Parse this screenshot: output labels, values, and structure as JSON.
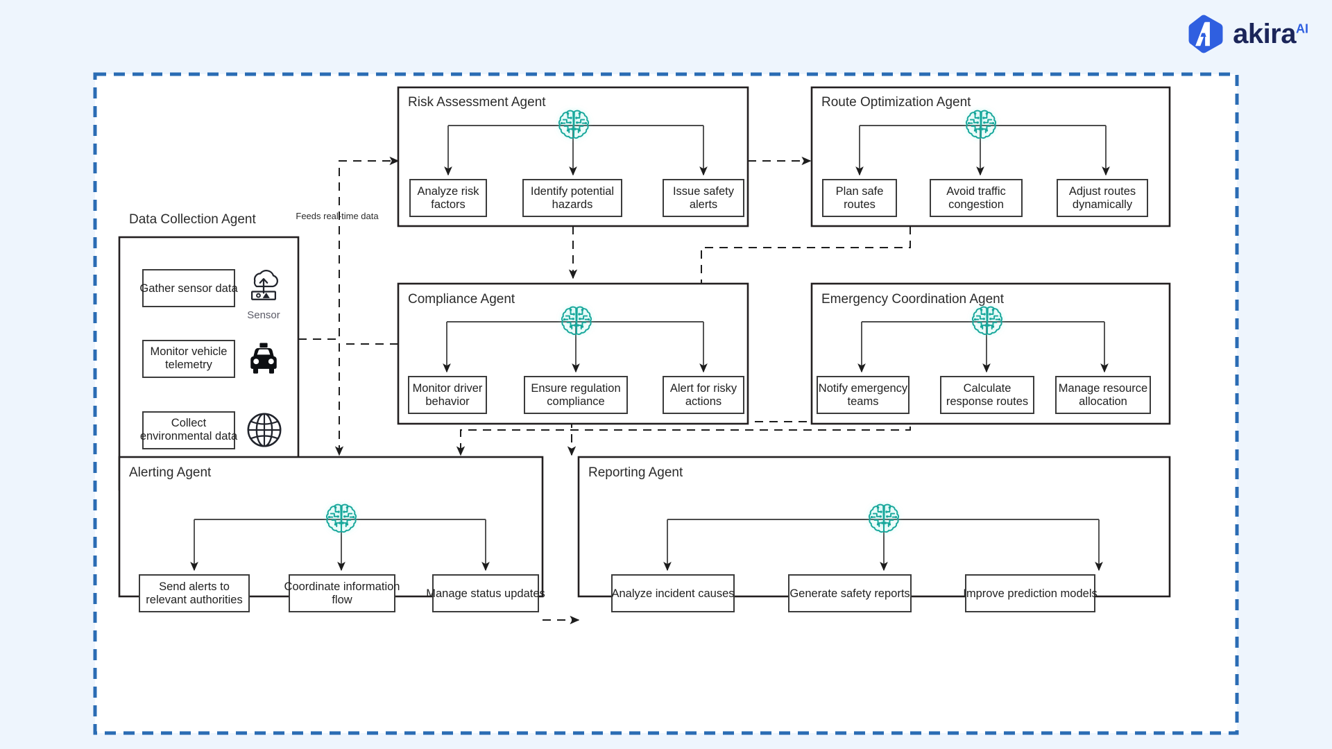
{
  "brand": {
    "name": "akira",
    "superscript": "AI",
    "mark_icon": "akira-hexagon-a-logo",
    "hex_color": "#2f5fe0",
    "word_color": "#1b2559"
  },
  "canvas": {
    "border_color": "#2a6cb4",
    "background": "#eef5fd",
    "surface": "#ffffff",
    "agent_icon": "circuit-brain-icon",
    "agent_icon_color": "#17a79b"
  },
  "agents": [
    {
      "id": "data-collection",
      "title": "Data Collection Agent",
      "layout": "vertical",
      "tasks": [
        {
          "label": "Gather sensor data",
          "icon": "cloud-sensor-icon",
          "caption": "Sensor"
        },
        {
          "label": "Monitor vehicle telemetry",
          "icon": "taxi-icon",
          "caption": ""
        },
        {
          "label": "Collect environmental data",
          "icon": "globe-icon",
          "caption": ""
        }
      ]
    },
    {
      "id": "risk-assessment",
      "title": "Risk Assessment Agent",
      "layout": "brain-fanout",
      "tasks": [
        {
          "label": "Analyze risk factors"
        },
        {
          "label": "Identify potential hazards"
        },
        {
          "label": "Issue safety alerts"
        }
      ]
    },
    {
      "id": "route-optimization",
      "title": "Route Optimization Agent",
      "layout": "brain-fanout",
      "tasks": [
        {
          "label": "Plan safe routes"
        },
        {
          "label": "Avoid traffic congestion"
        },
        {
          "label": "Adjust routes dynamically"
        }
      ]
    },
    {
      "id": "compliance",
      "title": "Compliance Agent",
      "layout": "brain-fanout",
      "tasks": [
        {
          "label": "Monitor driver behavior"
        },
        {
          "label": "Ensure regulation compliance"
        },
        {
          "label": "Alert for risky actions"
        }
      ]
    },
    {
      "id": "emergency-coordination",
      "title": "Emergency Coordination Agent",
      "layout": "brain-fanout",
      "tasks": [
        {
          "label": "Notify emergency teams"
        },
        {
          "label": "Calculate response routes"
        },
        {
          "label": "Manage resource allocation"
        }
      ]
    },
    {
      "id": "alerting",
      "title": "Alerting Agent",
      "layout": "brain-fanout",
      "tasks": [
        {
          "label": "Send alerts to relevant authorities"
        },
        {
          "label": "Coordinate information flow"
        },
        {
          "label": "Manage status updates"
        }
      ]
    },
    {
      "id": "reporting",
      "title": "Reporting Agent",
      "layout": "brain-fanout",
      "tasks": [
        {
          "label": "Analyze incident causes"
        },
        {
          "label": "Generate safety reports"
        },
        {
          "label": "Improve prediction models"
        }
      ]
    }
  ],
  "connections": [
    {
      "from": "data-collection",
      "to": "risk-assessment",
      "label": "Feeds real-time data",
      "style": "dashed"
    },
    {
      "from": "risk-assessment",
      "to": "route-optimization",
      "label": "",
      "style": "dashed"
    },
    {
      "from": "risk-assessment",
      "to": "compliance",
      "label": "",
      "style": "dashed"
    },
    {
      "from": "route-optimization",
      "to": "compliance",
      "label": "",
      "style": "dashed"
    },
    {
      "from": "emergency-coordination",
      "to": "compliance",
      "label": "",
      "style": "dashed"
    },
    {
      "from": "compliance",
      "to": "alerting",
      "label": "",
      "style": "dashed"
    },
    {
      "from": "emergency-coordination",
      "to": "alerting",
      "label": "",
      "style": "dashed"
    },
    {
      "from": "route-optimization",
      "to": "alerting",
      "label": "",
      "style": "dashed"
    },
    {
      "from": "alerting",
      "to": "reporting",
      "label": "",
      "style": "dashed"
    }
  ]
}
